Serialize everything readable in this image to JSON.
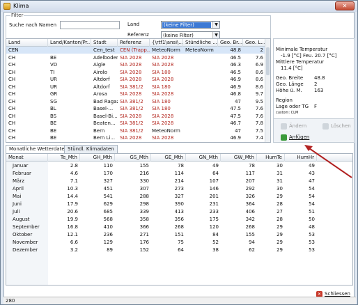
{
  "window": {
    "title": "Klima",
    "close_glyph": "✕"
  },
  "filter": {
    "group_title": "Filter",
    "search_label": "Suche nach Namen",
    "search_value": "",
    "land_label": "Land",
    "land_value": "(keine Filter)",
    "referenz_label": "Referenz",
    "referenz_value": "(keine Filter)"
  },
  "stations_table": {
    "headers": [
      "Land",
      "Land/Kanton/Pr...",
      "Stadt",
      "Referenz",
      "{\\rtf1\\ansi\\...",
      "Stündliche ...",
      "Geo. Br...",
      "Geo. L..."
    ],
    "rows": [
      [
        "CEN",
        "",
        "Cen_test",
        "CEN (Trapp...",
        "MeteoNorm",
        "MeteoNorm",
        "48.8",
        "2"
      ],
      [
        "CH",
        "BE",
        "Adelboden",
        "SIA 2028",
        "SIA 2028",
        "",
        "46.5",
        "7.6"
      ],
      [
        "CH",
        "VD",
        "Aigle",
        "SIA 2028",
        "SIA 2028",
        "",
        "46.3",
        "6.9"
      ],
      [
        "CH",
        "TI",
        "Airolo",
        "SIA 2028",
        "SIA 180",
        "",
        "46.5",
        "8.6"
      ],
      [
        "CH",
        "UR",
        "Altdorf",
        "SIA 2028",
        "SIA 2028",
        "",
        "46.9",
        "8.6"
      ],
      [
        "CH",
        "UR",
        "Altdorf",
        "SIA 381/2",
        "SIA 180",
        "",
        "46.9",
        "8.6"
      ],
      [
        "CH",
        "GR",
        "Arosa",
        "SIA 2028",
        "SIA 2028",
        "",
        "46.8",
        "9.7"
      ],
      [
        "CH",
        "SG",
        "Bad Ragaz",
        "SIA 381/2",
        "SIA 180",
        "",
        "47",
        "9.5"
      ],
      [
        "CH",
        "BL",
        "Basel-...",
        "SIA 381/2",
        "SIA 180",
        "",
        "47.5",
        "7.6"
      ],
      [
        "CH",
        "BS",
        "Basel-Bi...",
        "SIA 2028",
        "SIA 2028",
        "",
        "47.5",
        "7.6"
      ],
      [
        "CH",
        "BE",
        "Beaten...",
        "SIA 381/2",
        "SIA 2028",
        "",
        "46.7",
        "7.8"
      ],
      [
        "CH",
        "BE",
        "Bern",
        "SIA 381/2",
        "MeteoNorm",
        "",
        "47",
        "7.5"
      ],
      [
        "CH",
        "BE",
        "Bern Li...",
        "SIA 2028",
        "SIA 2028",
        "",
        "46.9",
        "7.4"
      ]
    ]
  },
  "side_panel": {
    "min_temp_label": "Minimale Temperatur",
    "min_temp_line": "-1.9   [°C] Feu.  20.7   [°C]",
    "mean_temp_label": "Mittlere Temperatur",
    "mean_temp_line": "11.4   [°C]",
    "lat_label": "Geo. Breite",
    "lat_value": "48.8",
    "lon_label": "Geo. Länge",
    "lon_value": "2",
    "alt_label": "Höhe ü. M.",
    "alt_value": "163",
    "region_label": "Region",
    "lage_label": "Lage oder TG",
    "lage_value": "F",
    "custom_line": "custom: CLM"
  },
  "buttons": {
    "aendern": "Ändern",
    "loeschen": "Löschen",
    "anfuegen": "Anfügen",
    "schliessen": "Schliessen"
  },
  "tabs": [
    "Monatliche Wetterdaten",
    "Stündl. Klimadaten"
  ],
  "monthly_table": {
    "headers": [
      "Monat",
      "Te_Mth",
      "GH_Mth",
      "GS_Mth",
      "GE_Mth",
      "GN_Mth",
      "GW_Mth",
      "HumTe",
      "HumHr"
    ],
    "rows": [
      [
        "Januar",
        "2.8",
        "110",
        "155",
        "78",
        "49",
        "78",
        "30",
        "49"
      ],
      [
        "Februar",
        "4.6",
        "170",
        "216",
        "114",
        "64",
        "117",
        "31",
        "43"
      ],
      [
        "März",
        "7.1",
        "327",
        "330",
        "214",
        "107",
        "207",
        "31",
        "47"
      ],
      [
        "April",
        "10.3",
        "451",
        "307",
        "273",
        "146",
        "292",
        "30",
        "54"
      ],
      [
        "Mai",
        "14.4",
        "541",
        "288",
        "327",
        "201",
        "326",
        "29",
        "54"
      ],
      [
        "Juni",
        "17.9",
        "629",
        "298",
        "390",
        "231",
        "364",
        "28",
        "54"
      ],
      [
        "Juli",
        "20.6",
        "685",
        "339",
        "413",
        "233",
        "406",
        "27",
        "51"
      ],
      [
        "August",
        "19.9",
        "568",
        "358",
        "356",
        "175",
        "342",
        "28",
        "50"
      ],
      [
        "September",
        "16.8",
        "410",
        "366",
        "268",
        "120",
        "268",
        "29",
        "48"
      ],
      [
        "Oktober",
        "12.1",
        "236",
        "271",
        "151",
        "84",
        "155",
        "29",
        "53"
      ],
      [
        "November",
        "6.6",
        "129",
        "176",
        "75",
        "52",
        "94",
        "29",
        "53"
      ],
      [
        "Dezember",
        "3.2",
        "89",
        "152",
        "64",
        "38",
        "62",
        "29",
        "53"
      ]
    ]
  },
  "status_bar": {
    "text": "280"
  },
  "colors": {
    "accent": "#3c79d4",
    "reference_red": "#b3261e",
    "annotation_arrow": "#b22222"
  }
}
